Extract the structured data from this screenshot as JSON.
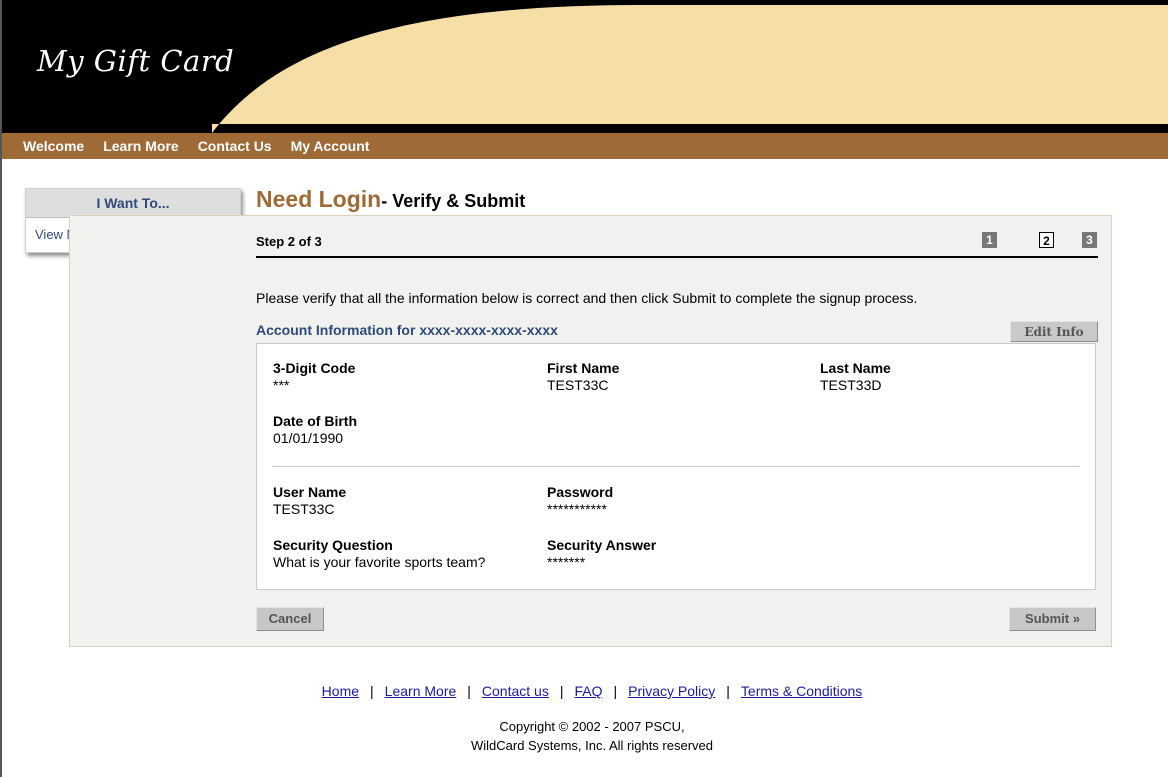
{
  "header": {
    "logo_text": "My Gift Card",
    "colors": {
      "bar": "#000000",
      "curve": "#f5dfa6",
      "nav": "#9e6a36",
      "accent": "#9e6a36",
      "link": "#2d4a7b"
    }
  },
  "nav": [
    "Welcome",
    "Learn More",
    "Contact Us",
    "My Account"
  ],
  "sidebar": {
    "title": "I Want To...",
    "items": [
      "View My Account"
    ]
  },
  "page": {
    "title_main": "Need Login",
    "title_rest": "- Verify & Submit",
    "step_label": "Step 2 of 3",
    "steps": [
      "1",
      "2",
      "3"
    ],
    "current_step": 2,
    "instruction": "Please verify that all the information below is correct and then click Submit to complete the signup process."
  },
  "account": {
    "title": "Account Information for xxxx-xxxx-xxxx-xxxx",
    "edit_label": "Edit Info",
    "fields": {
      "code": {
        "label": "3-Digit Code",
        "value": "***"
      },
      "first_name": {
        "label": "First Name",
        "value": "TEST33C"
      },
      "last_name": {
        "label": "Last Name",
        "value": "TEST33D"
      },
      "dob": {
        "label": "Date of Birth",
        "value": "01/01/1990"
      },
      "username": {
        "label": "User Name",
        "value": "TEST33C"
      },
      "password": {
        "label": "Password",
        "value": "***********"
      },
      "sec_question": {
        "label": "Security Question",
        "value": "What is your favorite sports team?"
      },
      "sec_answer": {
        "label": "Security Answer",
        "value": "*******"
      }
    }
  },
  "actions": {
    "cancel": "Cancel",
    "submit": "Submit »"
  },
  "footer": {
    "links": [
      "Home",
      "Learn More",
      "Contact us",
      "FAQ",
      "Privacy Policy",
      "Terms & Conditions"
    ],
    "separator": "|",
    "copyright_line1": "Copyright © 2002 - 2007 PSCU,",
    "copyright_line2": "WildCard Systems, Inc. All rights reserved"
  }
}
